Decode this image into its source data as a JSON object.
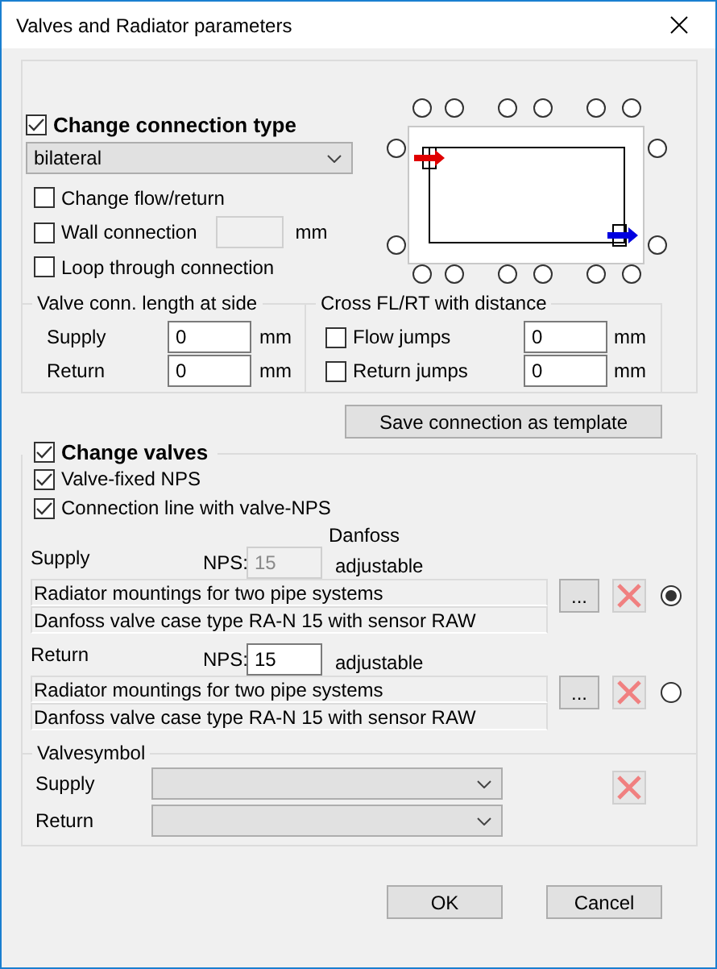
{
  "window": {
    "title": "Valves and Radiator parameters"
  },
  "connection": {
    "label": "Change connection type",
    "checked": true,
    "type": "bilateral",
    "options": [
      {
        "label": "Change flow/return",
        "checked": false
      },
      {
        "label": "Wall connection",
        "checked": false,
        "unit": "mm"
      },
      {
        "label": "Loop through connection",
        "checked": false
      }
    ],
    "valve_length": {
      "title": "Valve conn. length at side",
      "rows": [
        {
          "label": "Supply",
          "value": "0",
          "unit": "mm"
        },
        {
          "label": "Return",
          "value": "0",
          "unit": "mm"
        }
      ]
    },
    "cross": {
      "title": "Cross FL/RT with distance",
      "rows": [
        {
          "label": "Flow jumps",
          "checked": false,
          "value": "0",
          "unit": "mm"
        },
        {
          "label": "Return jumps",
          "checked": false,
          "value": "0",
          "unit": "mm"
        }
      ]
    }
  },
  "save_button": "Save connection as template",
  "valves": {
    "label": "Change valves",
    "checked": true,
    "options": [
      {
        "label": "Valve-fixed NPS",
        "checked": true
      },
      {
        "label": "Connection line with valve-NPS",
        "checked": true
      }
    ],
    "manufacturer": "Danfoss",
    "rows": [
      {
        "label": "Supply",
        "nps_label": "NPS:",
        "nps": "15",
        "disabled": true,
        "setting": "adjustable",
        "lines": [
          "Radiator mountings for two pipe systems",
          "Danfoss valve case type RA-N 15 with sensor RAW"
        ],
        "browse": "...",
        "selected": true
      },
      {
        "label": "Return",
        "nps_label": "NPS:",
        "nps": "15",
        "disabled": false,
        "setting": "adjustable",
        "lines": [
          "Radiator mountings for two pipe systems",
          "Danfoss valve case type RA-N 15 with sensor RAW"
        ],
        "browse": "...",
        "selected": false
      }
    ],
    "symbol": {
      "title": "Valvesymbol",
      "rows": [
        {
          "label": "Supply"
        },
        {
          "label": "Return"
        }
      ]
    }
  },
  "buttons": [
    "OK",
    "Cancel"
  ]
}
